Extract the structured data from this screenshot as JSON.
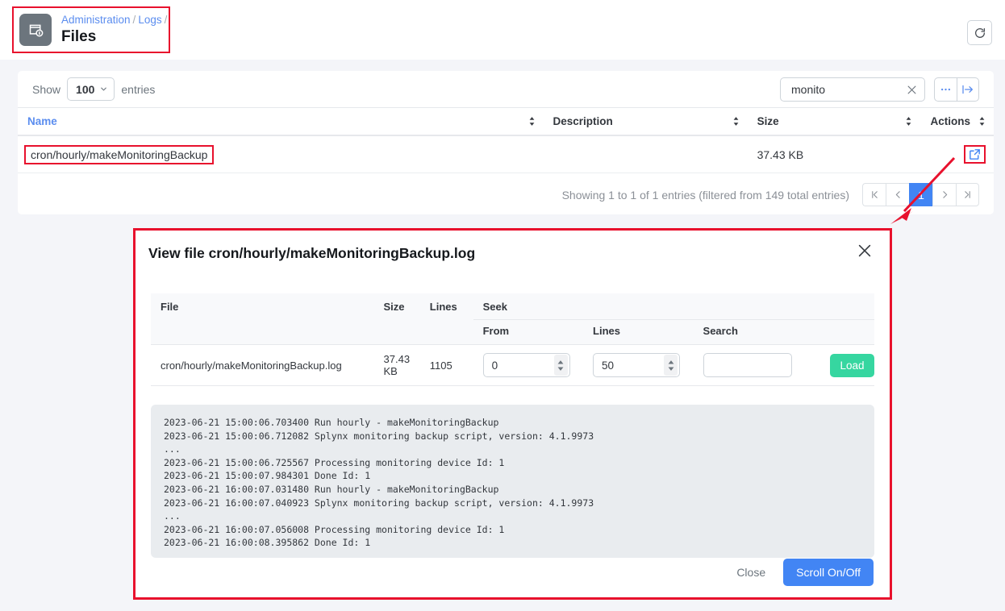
{
  "header": {
    "icon": "file-info-icon",
    "breadcrumb": [
      {
        "label": "Administration",
        "link": true
      },
      {
        "label": "Logs",
        "link": true
      }
    ],
    "separator": "/",
    "title": "Files",
    "refresh_icon": "refresh-icon"
  },
  "toolbar": {
    "show_label": "Show",
    "entries_value": "100",
    "entries_label": "entries",
    "search_value": "monito",
    "search_placeholder": "",
    "clear_icon": "close-x-icon",
    "more_icon": "ellipsis-icon",
    "export_icon": "export-arrow-icon"
  },
  "table": {
    "columns": [
      {
        "label": "Name",
        "active": true
      },
      {
        "label": "Description",
        "active": false
      },
      {
        "label": "Size",
        "active": false
      },
      {
        "label": "Actions",
        "active": false
      }
    ],
    "rows": [
      {
        "name": "cron/hourly/makeMonitoringBackup",
        "description": "",
        "size": "37.43 KB",
        "action_icon": "open-external-icon"
      }
    ]
  },
  "pagination": {
    "showing": "Showing 1 to 1 of 1 entries (filtered from 149 total entries)",
    "first": "|<",
    "prev": "<",
    "current_page": "1",
    "next": ">",
    "last": ">|"
  },
  "modal": {
    "title": "View file cron/hourly/makeMonitoringBackup.log",
    "close_icon": "close-x-icon",
    "columns": {
      "file": "File",
      "size": "Size",
      "lines": "Lines",
      "seek": "Seek",
      "from": "From",
      "seek_lines": "Lines",
      "search": "Search"
    },
    "row": {
      "file": "cron/hourly/makeMonitoringBackup.log",
      "size": "37.43 KB",
      "lines": "1105",
      "from_value": "0",
      "lines_value": "50",
      "search_value": "",
      "load_label": "Load"
    },
    "log_lines": [
      "2023-06-21 15:00:06.703400 Run hourly - makeMonitoringBackup",
      "2023-06-21 15:00:06.712082 Splynx monitoring backup script, version: 4.1.9973",
      "...",
      "2023-06-21 15:00:06.725567 Processing monitoring device Id: 1",
      "2023-06-21 15:00:07.984301 Done Id: 1",
      "2023-06-21 16:00:07.031480 Run hourly - makeMonitoringBackup",
      "2023-06-21 16:00:07.040923 Splynx monitoring backup script, version: 4.1.9973",
      "...",
      "2023-06-21 16:00:07.056008 Processing monitoring device Id: 1",
      "2023-06-21 16:00:08.395862 Done Id: 1"
    ],
    "close_label": "Close",
    "scroll_label": "Scroll On/Off"
  },
  "colors": {
    "accent_blue": "#4285f4",
    "link_blue": "#5b8def",
    "green": "#36d6a0",
    "annotation_red": "#e8112d",
    "page_bg": "#f4f5f9",
    "log_bg": "#e9ecef"
  }
}
